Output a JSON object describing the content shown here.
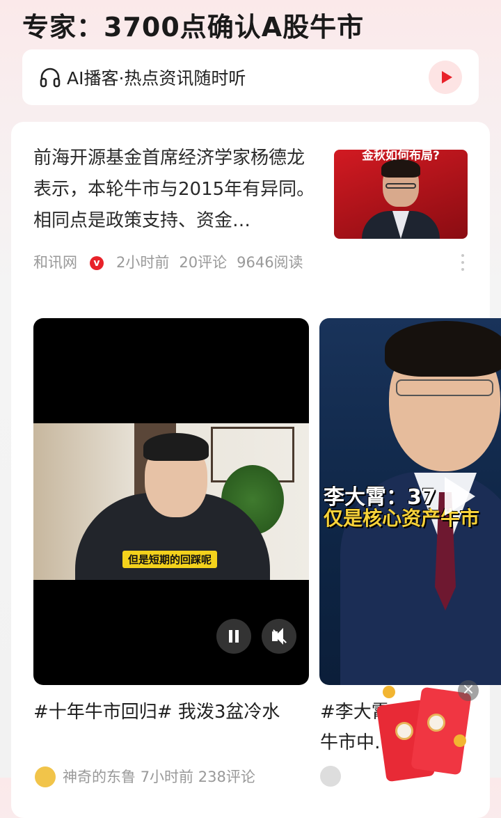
{
  "headline": "专家：3700点确认A股牛市",
  "podcast": {
    "label": "AI播客·热点资讯随时听"
  },
  "news": {
    "text": "前海开源基金首席经济学家杨德龙表示，本轮牛市与2015年有异同。相同点是政策支持、资金…",
    "thumb_caption": "金秋如何布局?",
    "source": "和讯网",
    "verified_badge": "v",
    "time": "2小时前",
    "comments": "20评论",
    "reads": "9646阅读"
  },
  "videos": [
    {
      "subtitle": "但是短期的回踩呢",
      "caption_tag": "#十年牛市回归#",
      "caption_text": " 我泼3盆冷水",
      "author": "神奇的东鲁",
      "time": "7小时前",
      "comments": "238评论"
    },
    {
      "overlay_line1": "李大霄：37",
      "overlay_line2": "仅是核心资产牛市",
      "caption_line1": "#李大霄…点仅",
      "caption_line2": "牛市中…股"
    }
  ],
  "close_glyph": "×",
  "colors": {
    "accent": "#e8222a",
    "subtitle_bg": "#f4d21c"
  },
  "icons": [
    "headphones-icon",
    "play-icon",
    "verified-icon",
    "more-icon",
    "pause-icon",
    "mute-icon",
    "close-icon"
  ]
}
